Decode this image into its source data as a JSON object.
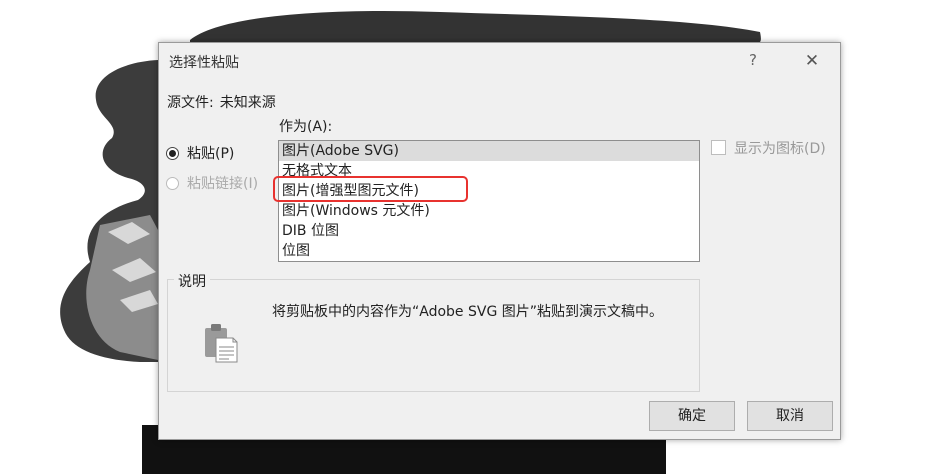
{
  "dialog": {
    "title": "选择性粘贴",
    "help": "?",
    "close": "✕"
  },
  "source": {
    "label": "源文件:",
    "value": "未知来源"
  },
  "as_label": "作为(A):",
  "options": {
    "paste": "粘贴(P)",
    "paste_link": "粘贴链接(I)"
  },
  "formats": [
    "图片(Adobe SVG)",
    "无格式文本",
    "图片(增强型图元文件)",
    "图片(Windows 元文件)",
    "DIB 位图",
    "位图"
  ],
  "display_as_icon": "显示为图标(D)",
  "description": {
    "legend": "说明",
    "text": "将剪贴板中的内容作为“Adobe SVG 图片”粘贴到演示文稿中。"
  },
  "buttons": {
    "ok": "确定",
    "cancel": "取消"
  }
}
